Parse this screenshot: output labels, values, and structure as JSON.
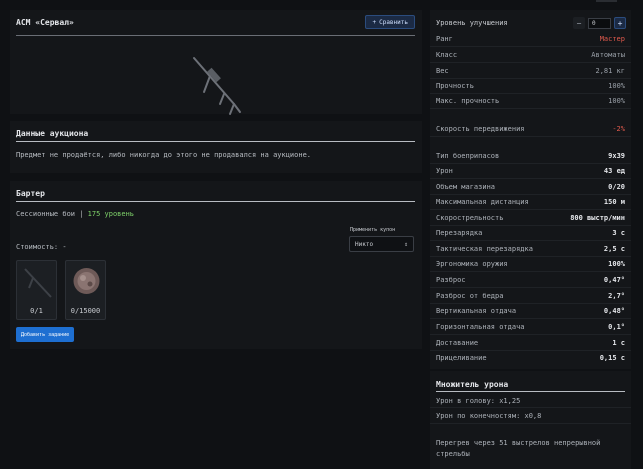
{
  "weapon": {
    "title": "АСМ «Сервал»",
    "compare_label": "Сравнить"
  },
  "auction": {
    "title": "Данные аукциона",
    "text": "Предмет не продаётся, либо никогда до этого не продавался на аукционе."
  },
  "barter": {
    "title": "Бартер",
    "session_label": "Сессионные бои |",
    "session_value": "175 уровень",
    "coupon_label": "Применить купон",
    "coupon_value": "Никто",
    "cost_label": "Стоимость: -",
    "slots": [
      {
        "count": "0/1"
      },
      {
        "count": "0/15000"
      }
    ],
    "add_label": "Добавить задание"
  },
  "stats": {
    "upgrade_label": "Уровень улучшения",
    "upgrade_value": "0",
    "rows": [
      {
        "k": "Ранг",
        "v": "Мастер"
      },
      {
        "k": "Класс",
        "v": "Автоматы"
      },
      {
        "k": "Вес",
        "v": "2,81 кг"
      },
      {
        "k": "Прочность",
        "v": "100%"
      },
      {
        "k": "Макс. прочность",
        "v": "100%"
      },
      {
        "k": "Скорость передвижения",
        "v": "-2%"
      },
      {
        "k": "Тип боеприпасов",
        "v": "9x39"
      },
      {
        "k": "Урон",
        "v": "43 ед"
      },
      {
        "k": "Объем магазина",
        "v": "0/20"
      },
      {
        "k": "Максимальная дистанция",
        "v": "150 м"
      },
      {
        "k": "Скорострельность",
        "v": "800 выстр/мин"
      },
      {
        "k": "Перезарядка",
        "v": "3 с"
      },
      {
        "k": "Тактическая перезарядка",
        "v": "2,5 с"
      },
      {
        "k": "Эргономика оружия",
        "v": "100%"
      },
      {
        "k": "Разброс",
        "v": "0,47°"
      },
      {
        "k": "Разброс от бедра",
        "v": "2,7°"
      },
      {
        "k": "Вертикальная отдача",
        "v": "0,48°"
      },
      {
        "k": "Горизонтальная отдача",
        "v": "0,1°"
      },
      {
        "k": "Доставание",
        "v": "1 с"
      },
      {
        "k": "Прицеливание",
        "v": "0,15 с"
      }
    ]
  },
  "damage": {
    "title": "Множитель урона",
    "head": "Урон в голову: x1,25",
    "limbs": "Урон по конечностям: x0,8",
    "overheat": "Перегрев через 51 выстрелов непрерывной стрельбы"
  },
  "colors": {
    "accent": "#1e6fd1",
    "green": "#7fd36a",
    "red": "#e05a4d"
  }
}
